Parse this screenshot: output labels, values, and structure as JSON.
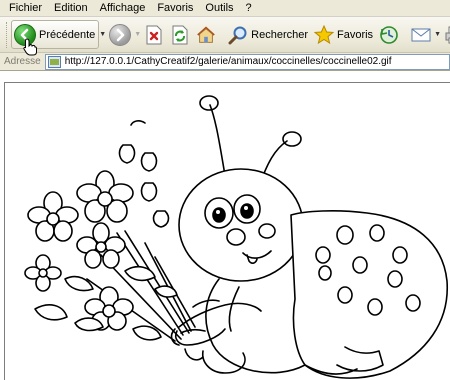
{
  "menu": [
    "Fichier",
    "Edition",
    "Affichage",
    "Favoris",
    "Outils",
    "?"
  ],
  "toolbar": {
    "back_label": "Précédente",
    "search_label": "Rechercher",
    "favorites_label": "Favoris"
  },
  "address": {
    "label": "Adresse",
    "url": "http://127.0.0.1/CathyCreatif2/galerie/animaux/coccinelles/coccinelle02.gif"
  },
  "colors": {
    "chrome": "#ece9d8",
    "back_green": "#1f8a1a",
    "stop_red": "#cc2222",
    "star_yellow": "#f5c800"
  },
  "icons": [
    "back-icon",
    "forward-icon",
    "stop-icon",
    "refresh-icon",
    "home-icon",
    "search-icon",
    "favorites-star-icon",
    "history-icon",
    "mail-icon",
    "print-icon",
    "pointer-cursor-icon"
  ]
}
